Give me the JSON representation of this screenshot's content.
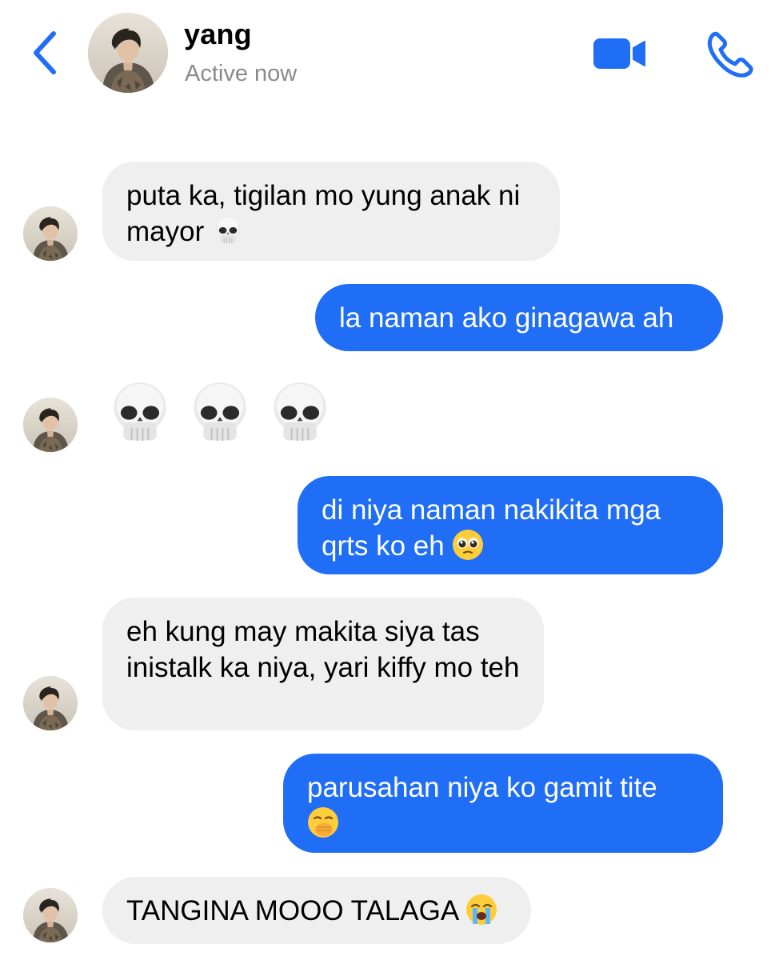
{
  "header": {
    "back_icon": "chevron-left-icon",
    "contact_name": "yang",
    "status": "Active now",
    "video_icon": "video-camera-icon",
    "call_icon": "phone-icon",
    "accent_color": "#1f6ef5"
  },
  "messages": [
    {
      "direction": "incoming",
      "text": "puta ka, tigilan mo yung anak ni mayor",
      "emoji": "skull"
    },
    {
      "direction": "outgoing",
      "text": "la naman ako ginagawa ah"
    },
    {
      "direction": "incoming",
      "emoji_only": [
        "skull",
        "skull",
        "skull"
      ]
    },
    {
      "direction": "outgoing",
      "text": "di niya naman nakikita mga qrts ko eh",
      "emoji": "pleading-face"
    },
    {
      "direction": "incoming",
      "text": "eh kung may makita siya tas inistalk ka niya, yari kiffy mo teh"
    },
    {
      "direction": "outgoing",
      "text": "parusahan niya ko gamit tite",
      "emoji": "hand-over-mouth"
    },
    {
      "direction": "incoming",
      "text": "TANGINA MOOO TALAGA",
      "emoji": "loudly-crying-face"
    }
  ],
  "colors": {
    "incoming_bubble": "#efeff0",
    "outgoing_bubble": "#1f6ef5",
    "status_text": "#8a8a8e"
  }
}
